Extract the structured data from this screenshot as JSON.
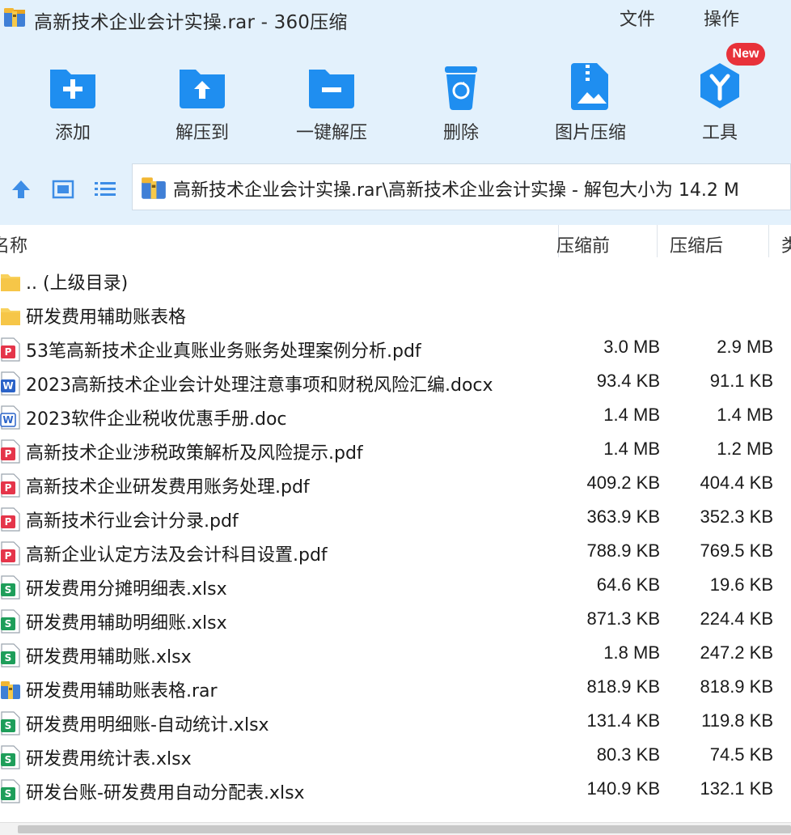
{
  "window": {
    "title": "高新技术企业会计实操.rar - 360压缩",
    "menu": {
      "file": "文件",
      "ops": "操作"
    }
  },
  "toolbar": {
    "items": [
      {
        "label": "添加",
        "icon": "add-folder-icon"
      },
      {
        "label": "解压到",
        "icon": "extract-to-icon"
      },
      {
        "label": "一键解压",
        "icon": "one-click-extract-icon"
      },
      {
        "label": "删除",
        "icon": "delete-icon"
      },
      {
        "label": "图片压缩",
        "icon": "image-compress-icon"
      },
      {
        "label": "工具",
        "icon": "tools-icon"
      }
    ],
    "new_badge": "New"
  },
  "address": {
    "path": "高新技术企业会计实操.rar\\高新技术企业会计实操 - 解包大小为 14.2 M"
  },
  "columns": {
    "name": "名称",
    "size": "压缩前",
    "compressed": "压缩后",
    "type": "类"
  },
  "files": [
    {
      "name": ".. (上级目录)",
      "size": "",
      "compressed": "",
      "kind": "folder"
    },
    {
      "name": "研发费用辅助账表格",
      "size": "",
      "compressed": "",
      "kind": "folder"
    },
    {
      "name": "53笔高新技术企业真账业务账务处理案例分析.pdf",
      "size": "3.0 MB",
      "compressed": "2.9 MB",
      "kind": "pdf"
    },
    {
      "name": "2023高新技术企业会计处理注意事项和财税风险汇编.docx",
      "size": "93.4 KB",
      "compressed": "91.1 KB",
      "kind": "word"
    },
    {
      "name": "2023软件企业税收优惠手册.doc",
      "size": "1.4 MB",
      "compressed": "1.4 MB",
      "kind": "word-outline"
    },
    {
      "name": "高新技术企业涉税政策解析及风险提示.pdf",
      "size": "1.4 MB",
      "compressed": "1.2 MB",
      "kind": "pdf"
    },
    {
      "name": "高新技术企业研发费用账务处理.pdf",
      "size": "409.2 KB",
      "compressed": "404.4 KB",
      "kind": "pdf"
    },
    {
      "name": "高新技术行业会计分录.pdf",
      "size": "363.9 KB",
      "compressed": "352.3 KB",
      "kind": "pdf"
    },
    {
      "name": "高新企业认定方法及会计科目设置.pdf",
      "size": "788.9 KB",
      "compressed": "769.5 KB",
      "kind": "pdf"
    },
    {
      "name": "研发费用分摊明细表.xlsx",
      "size": "64.6 KB",
      "compressed": "19.6 KB",
      "kind": "sheet"
    },
    {
      "name": "研发费用辅助明细账.xlsx",
      "size": "871.3 KB",
      "compressed": "224.4 KB",
      "kind": "sheet"
    },
    {
      "name": "研发费用辅助账.xlsx",
      "size": "1.8 MB",
      "compressed": "247.2 KB",
      "kind": "sheet"
    },
    {
      "name": "研发费用辅助账表格.rar",
      "size": "818.9 KB",
      "compressed": "818.9 KB",
      "kind": "rar"
    },
    {
      "name": "研发费用明细账-自动统计.xlsx",
      "size": "131.4 KB",
      "compressed": "119.8 KB",
      "kind": "sheet"
    },
    {
      "name": "研发费用统计表.xlsx",
      "size": "80.3 KB",
      "compressed": "74.5 KB",
      "kind": "sheet"
    },
    {
      "name": "研发台账-研发费用自动分配表.xlsx",
      "size": "140.9 KB",
      "compressed": "132.1 KB",
      "kind": "sheet"
    }
  ],
  "colors": {
    "toolbar_bg": "#e3f1fc",
    "icon_blue": "#1f8ef0",
    "pdf_red": "#e5354a",
    "sheet_green": "#1e9e5a",
    "word_blue": "#2b63c8",
    "folder_yellow": "#f8d15c",
    "badge_red": "#e8323a"
  }
}
